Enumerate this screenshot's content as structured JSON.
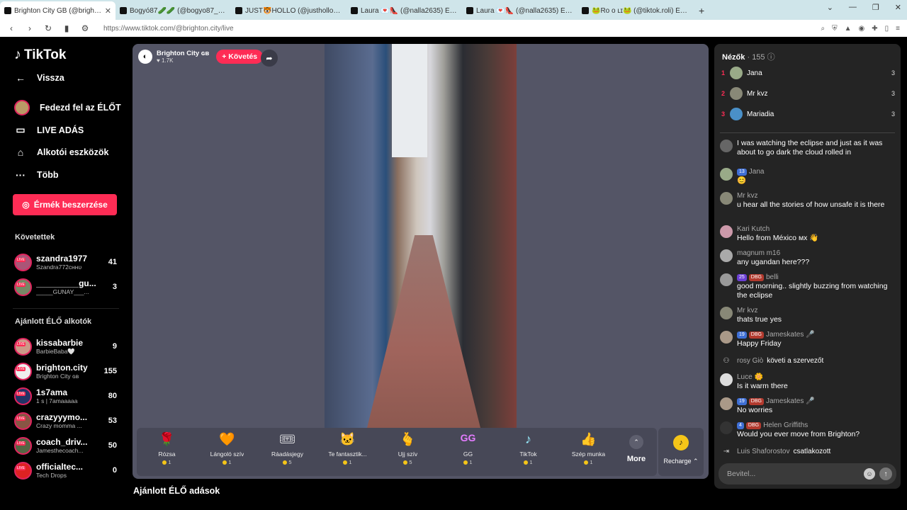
{
  "browser": {
    "tabs": [
      {
        "title": "Brighton City GB (@brighton...",
        "active": true
      },
      {
        "title": "Bogyó87🥒🥒 (@bogyo87_) ÉLŐ a",
        "active": false
      },
      {
        "title": "JUST🐯HOLLO (@justholloadam) ÉLŐ",
        "active": false
      },
      {
        "title": "Laura 💌👠 (@nalla2635) ÉLŐ adá",
        "active": false
      },
      {
        "title": "Laura 💌👠 (@nalla2635) ÉLŐ adá",
        "active": false
      },
      {
        "title": "🐸Ro o ʟɪ🐸 (@tiktok.roli) ÉLŐ adá",
        "active": false
      }
    ],
    "url": "https://www.tiktok.com/@brighton.city/live"
  },
  "sidebar": {
    "logo": "TikTok",
    "back": "Vissza",
    "nav": [
      {
        "label": "Fedezd fel az ÉLŐT"
      },
      {
        "label": "LIVE ADÁS"
      },
      {
        "label": "Alkotói eszközök"
      },
      {
        "label": "Több"
      }
    ],
    "coins_button": "Érmék beszerzése",
    "following_title": "Követettek",
    "following": [
      {
        "name": "szandra1977",
        "sub": "Szandra772ᴄʜʜᴜ",
        "count": "41"
      },
      {
        "name": "_________gu...",
        "sub": "_____GUNAY___...",
        "count": "3"
      }
    ],
    "recommended_title": "Ajánlott ÉLŐ alkotók",
    "recommended": [
      {
        "name": "kissabarbie",
        "sub": "BarbieBaba🤍",
        "count": "9"
      },
      {
        "name": "brighton.city",
        "sub": "Brighton City ɢʙ",
        "count": "155"
      },
      {
        "name": "1s7ama",
        "sub": "1 s | 7amaaaaa",
        "count": "80"
      },
      {
        "name": "crazyyymo...",
        "sub": "Crazy momma ...",
        "count": "53"
      },
      {
        "name": "coach_driv...",
        "sub": "Jamesthecoach...",
        "count": "50"
      },
      {
        "name": "officialtec...",
        "sub": "Tech Drops",
        "count": "0"
      }
    ]
  },
  "player": {
    "host_name": "Brighton City ɢʙ",
    "host_likes": "♥ 1.7K",
    "follow_label": "+ Követés",
    "gifts": [
      {
        "icon": "🌹",
        "name": "Rózsa",
        "price": "1"
      },
      {
        "icon": "🧡",
        "name": "Lángoló szív",
        "price": "1"
      },
      {
        "icon": "🎟",
        "name": "Ráadásjegy",
        "price": "5"
      },
      {
        "icon": "🐱",
        "name": "Te fantasztik...",
        "price": "1"
      },
      {
        "icon": "🫰",
        "name": "Ujj szív",
        "price": "5"
      },
      {
        "icon": "GG",
        "name": "GG",
        "price": "1"
      },
      {
        "icon": "♪",
        "name": "TikTok",
        "price": "1"
      },
      {
        "icon": "👍",
        "name": "Szép munka",
        "price": "1"
      }
    ],
    "more_label": "More",
    "recharge_label": "Recharge ⌃"
  },
  "recommended_section": "Ajánlott ÉLŐ adások",
  "viewers": {
    "title": "Nézők",
    "count": "· 155",
    "top": [
      {
        "rank": "1",
        "name": "Jana",
        "score": "3"
      },
      {
        "rank": "2",
        "name": "Mr kvz",
        "score": "3"
      },
      {
        "rank": "3",
        "name": "Mariadia",
        "score": "3"
      }
    ]
  },
  "chat": [
    {
      "user": "",
      "text": "I was watching the eclipse and just as it was about to go dark the cloud rolled in"
    },
    {
      "user": "Jana",
      "badges": [
        {
          "t": "13",
          "c": "blue"
        }
      ],
      "text": "😊"
    },
    {
      "user": "Mr kvz",
      "text": "u hear all the stories of how unsafe it is there"
    },
    {
      "user": "Kari Kutch",
      "text": "Hello from México ᴍx 👋"
    },
    {
      "user": "magnum m16",
      "text": "any ugandan here???"
    },
    {
      "user": "belli",
      "badges": [
        {
          "t": "25",
          "c": "purple"
        },
        {
          "t": "DBG",
          "c": "red"
        }
      ],
      "text": "good morning.. slightly buzzing from watching the eclipse"
    },
    {
      "user": "Mr kvz",
      "text": "thats true yes"
    },
    {
      "user": "Jameskates 🎤",
      "badges": [
        {
          "t": "19",
          "c": "blue"
        },
        {
          "t": "DBG",
          "c": "red"
        }
      ],
      "text": "Happy Friday"
    },
    {
      "user": "rosy Giò",
      "system": "követi a szervezőt"
    },
    {
      "user": "Luce 🌼",
      "text": "Is it warm there"
    },
    {
      "user": "Jameskates 🎤",
      "badges": [
        {
          "t": "19",
          "c": "blue"
        },
        {
          "t": "DBG",
          "c": "red"
        }
      ],
      "text": "No worries"
    },
    {
      "user": "Helen Griffiths",
      "badges": [
        {
          "t": "4",
          "c": "blue"
        },
        {
          "t": "DBG",
          "c": "red"
        }
      ],
      "text": "Would you ever move from Brighton?"
    },
    {
      "user": "Luis Shaforostov",
      "system": "csatlakozott"
    }
  ],
  "input_placeholder": "Bevitel..."
}
